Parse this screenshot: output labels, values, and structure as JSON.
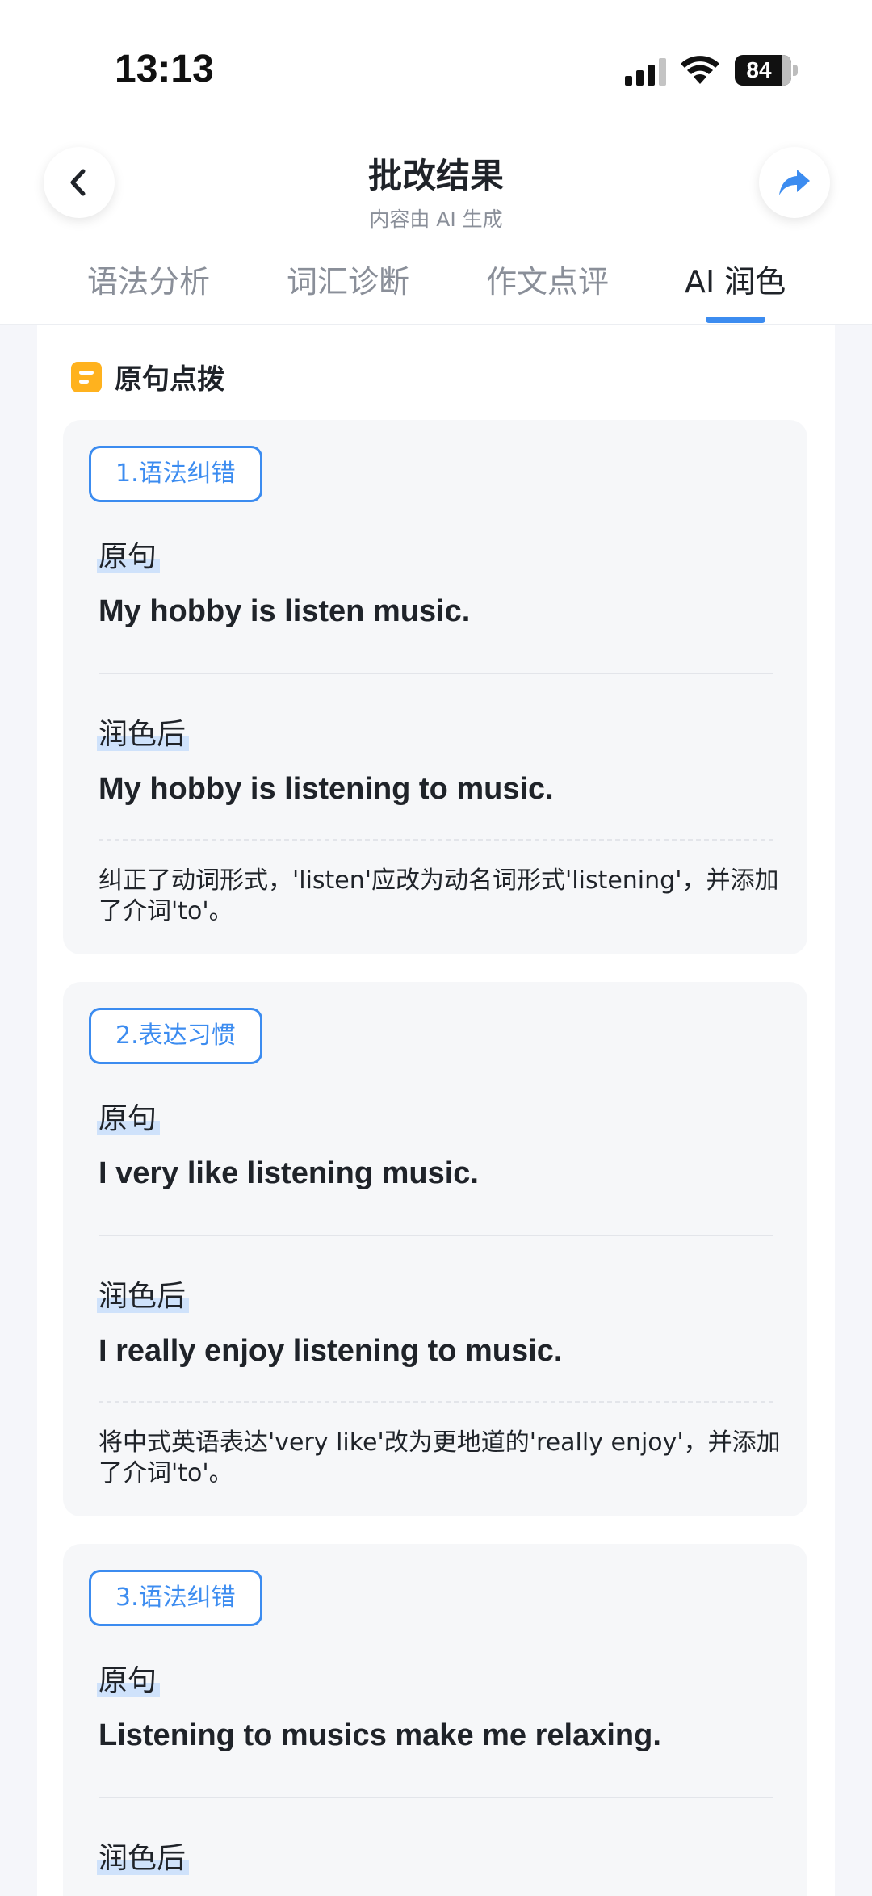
{
  "status": {
    "time": "13:13",
    "battery": "84"
  },
  "header": {
    "title": "批改结果",
    "subtitle": "内容由 AI 生成"
  },
  "tabs": [
    {
      "label": "语法分析"
    },
    {
      "label": "词汇诊断"
    },
    {
      "label": "作文点评"
    },
    {
      "label": "AI 润色",
      "active": true
    }
  ],
  "section": {
    "title": "原句点拨"
  },
  "labels": {
    "original": "原句",
    "polished": "润色后"
  },
  "items": [
    {
      "tag": "1.语法纠错",
      "original": "My hobby is listen music.",
      "polished": "My hobby is listening to music.",
      "note": "纠正了动词形式，'listen'应改为动名词形式'listening'，并添加了介词'to'。"
    },
    {
      "tag": "2.表达习惯",
      "original": "I very like listening music.",
      "polished": "I really enjoy listening to music.",
      "note": "将中式英语表达'very like'改为更地道的'really enjoy'，并添加了介词'to'。"
    },
    {
      "tag": "3.语法纠错",
      "original": "Listening to musics make me relaxing.",
      "polished": "",
      "note": ""
    }
  ],
  "colors": {
    "accent": "#3c8cf0",
    "section_icon": "#ffb21e",
    "label_highlight": "#cfe2fb"
  },
  "icons": {
    "back": "chevron-left-icon",
    "share": "share-arrow-icon",
    "section": "note-icon"
  }
}
